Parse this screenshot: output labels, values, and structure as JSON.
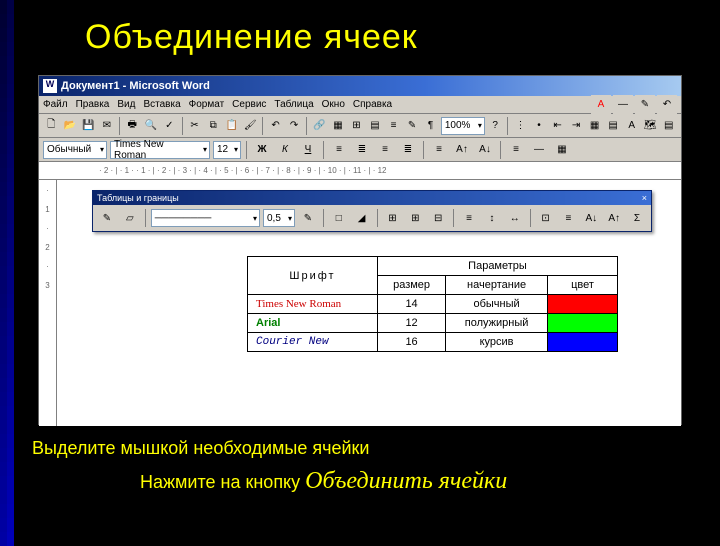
{
  "slide": {
    "title": "Объединение ячеек",
    "caption1": "Выделите мышкой необходимые ячейки",
    "caption2_prefix": "Нажмите на кнопку ",
    "caption2_action": "Объединить ячейки"
  },
  "window": {
    "title": "Документ1 - Microsoft Word",
    "menu": [
      "Файл",
      "Правка",
      "Вид",
      "Вставка",
      "Формат",
      "Сервис",
      "Таблица",
      "Окно",
      "Справка"
    ],
    "style": "Обычный",
    "font": "Times New Roman",
    "size": "12",
    "zoom": "100%",
    "bold": "Ж",
    "italic": "К",
    "underline": "Ч"
  },
  "float_toolbar": {
    "title": "Таблицы и границы",
    "close": "×",
    "line_weight": "0,5"
  },
  "ruler_h": "· 2 · | · 1 ·     · 1 · | · 2 · | · 3 · | · 4 · | · 5 · | · 6 · | · 7 · | · 8 · | · 9 · | · 10 · | · 11 · | · 12",
  "ruler_v": [
    "·",
    "1",
    "·",
    "2",
    "·",
    "3",
    "·"
  ],
  "table": {
    "h1": "Шрифт",
    "h2": "Параметры",
    "sub": [
      "размер",
      "начертание",
      "цвет"
    ],
    "rows": [
      {
        "font": "Times New Roman",
        "size": "14",
        "style": "обычный",
        "color": "#ff0000",
        "fontfam": "Times New Roman, serif",
        "fcolor": "#cc0000",
        "fstyle": "normal",
        "fweight": "normal"
      },
      {
        "font": "Arial",
        "size": "12",
        "style": "полужирный",
        "color": "#00ff00",
        "fontfam": "Arial, sans-serif",
        "fcolor": "#008000",
        "fstyle": "normal",
        "fweight": "bold"
      },
      {
        "font": "Courier New",
        "size": "16",
        "style": "курсив",
        "color": "#0000ff",
        "fontfam": "Courier New, monospace",
        "fcolor": "#000080",
        "fstyle": "italic",
        "fweight": "normal"
      }
    ]
  },
  "icons": {
    "new": "🗋",
    "open": "📂",
    "save": "💾",
    "mail": "✉",
    "print": "🖶",
    "preview": "🔍",
    "spell": "✓",
    "cut": "✂",
    "copy": "⧉",
    "paste": "📋",
    "fmt_paint": "🖌",
    "undo": "↶",
    "redo": "↷",
    "link": "🔗",
    "tables_borders": "▦",
    "insert_table": "⊞",
    "excel": "▤",
    "cols": "≡",
    "draw": "✎",
    "show": "¶",
    "map": "🗺",
    "help": "?",
    "align_l": "≡",
    "align_c": "≣",
    "align_r": "≡",
    "justify": "≣",
    "list_num": "⋮",
    "list_bul": "•",
    "outdent": "⇤",
    "indent": "⇥",
    "borders": "▦",
    "highlight": "▤",
    "fontcolor": "A",
    "dash": "—",
    "line_dd": "▾",
    "pencil": "✎",
    "eraser": "▱",
    "fill": "◢",
    "border_dd": "□",
    "merge": "⊞",
    "split": "⊟",
    "align_tbl": "≡",
    "dist_rows": "↕",
    "dist_cols": "↔",
    "autofmt": "⊡",
    "sort_az": "A↓",
    "sort_za": "A↑",
    "sum": "Σ"
  }
}
